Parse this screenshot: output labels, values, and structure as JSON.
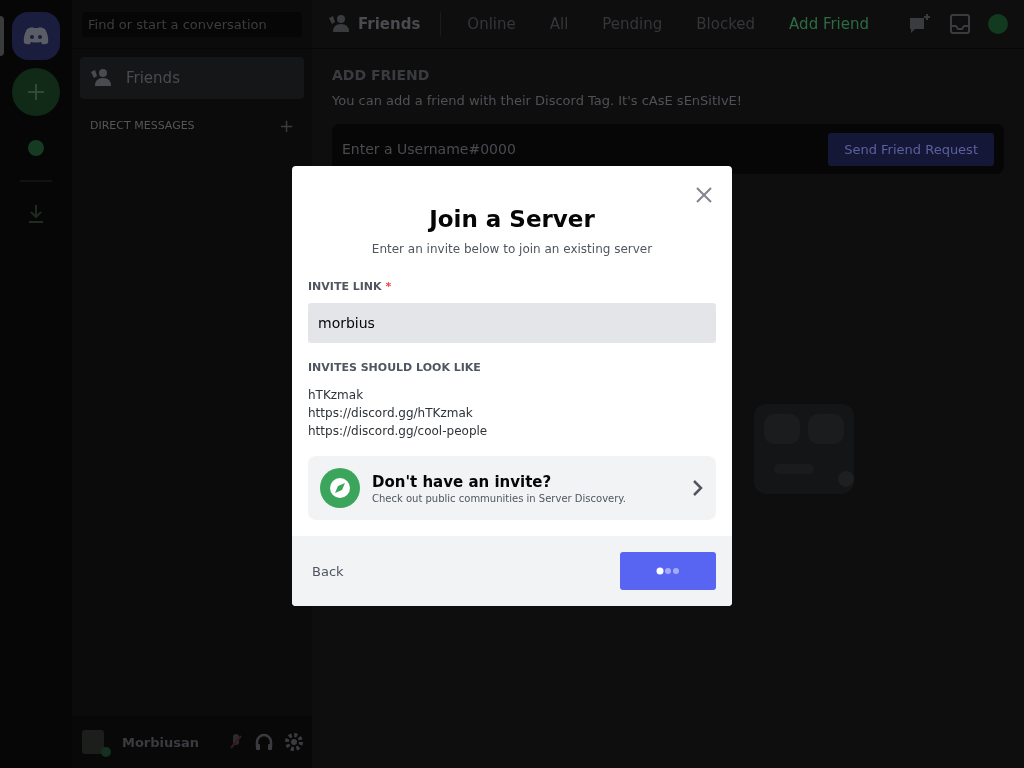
{
  "sidebar": {
    "search": {
      "placeholder": "Find or start a conversation"
    },
    "items": [
      {
        "label": "Friends",
        "selected": true
      }
    ],
    "section": "DIRECT MESSAGES",
    "section_action": "+"
  },
  "user": {
    "name": "Morbiusan"
  },
  "header": {
    "title": "Friends",
    "tabs": [
      {
        "label": "Online",
        "selected": false,
        "kind": "tab"
      },
      {
        "label": "All",
        "selected": false,
        "kind": "tab"
      },
      {
        "label": "Pending",
        "selected": false,
        "kind": "tab"
      },
      {
        "label": "Blocked",
        "selected": false,
        "kind": "tab"
      },
      {
        "label": "Add Friend",
        "selected": true,
        "kind": "action"
      }
    ]
  },
  "add_friend": {
    "title": "ADD FRIEND",
    "description": "You can add a friend with their Discord Tag. It's cAsE sEnSitIvE!",
    "placeholder": "Enter a Username#0000",
    "button": "Send Friend Request"
  },
  "modal": {
    "title": "Join a Server",
    "subtitle": "Enter an invite below to join an existing server",
    "field_label": "INVITE LINK",
    "required_mark": "*",
    "value": "morbius",
    "examples_title": "INVITES SHOULD LOOK LIKE",
    "examples": [
      "hTKzmak",
      "https://discord.gg/hTKzmak",
      "https://discord.gg/cool-people"
    ],
    "discovery": {
      "title": "Don't have an invite?",
      "subtitle": "Check out public communities in Server Discovery."
    },
    "back": "Back",
    "submit_loading": true
  }
}
